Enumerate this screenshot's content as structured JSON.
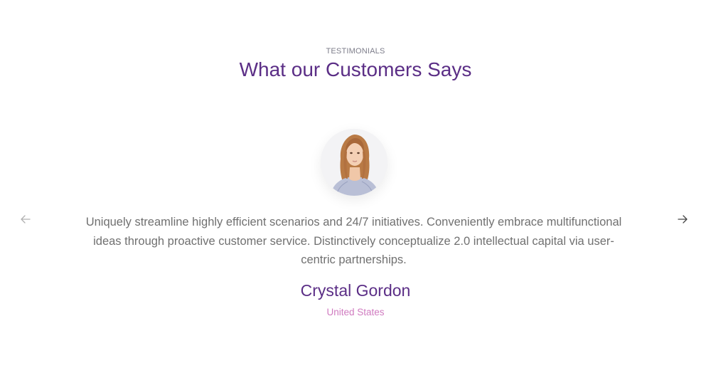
{
  "section": {
    "eyebrow": "TESTIMONIALS",
    "title": "What our Customers Says"
  },
  "testimonial": {
    "quote": "Uniquely streamline highly efficient scenarios and 24/7 initiatives. Conveniently embrace multifunctional ideas through proactive customer service. Distinctively conceptualize 2.0 intellectual capital via user-centric partnerships.",
    "name": "Crystal Gordon",
    "country": "United States"
  },
  "controls": {
    "prev_icon": "arrow-left-icon",
    "next_icon": "arrow-right-icon"
  },
  "colors": {
    "heading": "#5b2e86",
    "country": "#d07bc0",
    "body_text": "#707070"
  }
}
